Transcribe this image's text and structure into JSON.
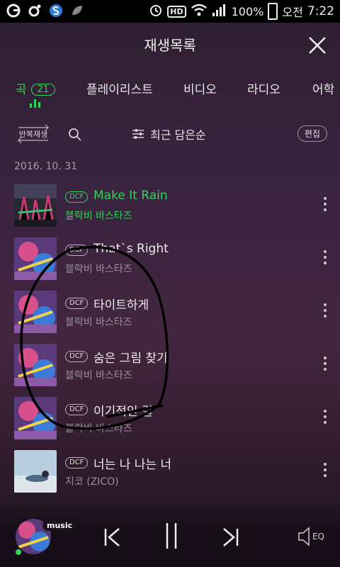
{
  "status_bar": {
    "battery": "100%",
    "ampm": "오전",
    "time": "7:22",
    "hd": "HD"
  },
  "header": {
    "title": "재생목록"
  },
  "tabs": [
    {
      "label": "곡",
      "count": "21",
      "active": true
    },
    {
      "label": "플레이리스트"
    },
    {
      "label": "비디오"
    },
    {
      "label": "라디오"
    },
    {
      "label": "어학"
    }
  ],
  "toolbar": {
    "repeat_label": "반복재생",
    "sort_label": "최근 담은순",
    "edit_label": "편집"
  },
  "date_header": "2016. 10. 31",
  "songs": [
    {
      "format": "DCF",
      "title": "Make It Rain",
      "artist": "블락비 바스타즈",
      "playing": true
    },
    {
      "format": "DCF",
      "title": "That`s Right",
      "artist": "블락비 바스타즈"
    },
    {
      "format": "DCF",
      "title": "타이트하게",
      "artist": "블락비 바스타즈"
    },
    {
      "format": "DCF",
      "title": "숨은 그림 찾기",
      "artist": "블락비 바스타즈"
    },
    {
      "format": "DCF",
      "title": "이기적인 걸",
      "artist": "블락비 바스타즈"
    },
    {
      "format": "DCF",
      "title": "너는 나 나는 너",
      "artist": "지코 (ZICO)"
    }
  ],
  "player": {
    "badge": "music",
    "eq_label": "EQ"
  },
  "colors": {
    "accent": "#32d35a",
    "background": "#3a2440"
  }
}
